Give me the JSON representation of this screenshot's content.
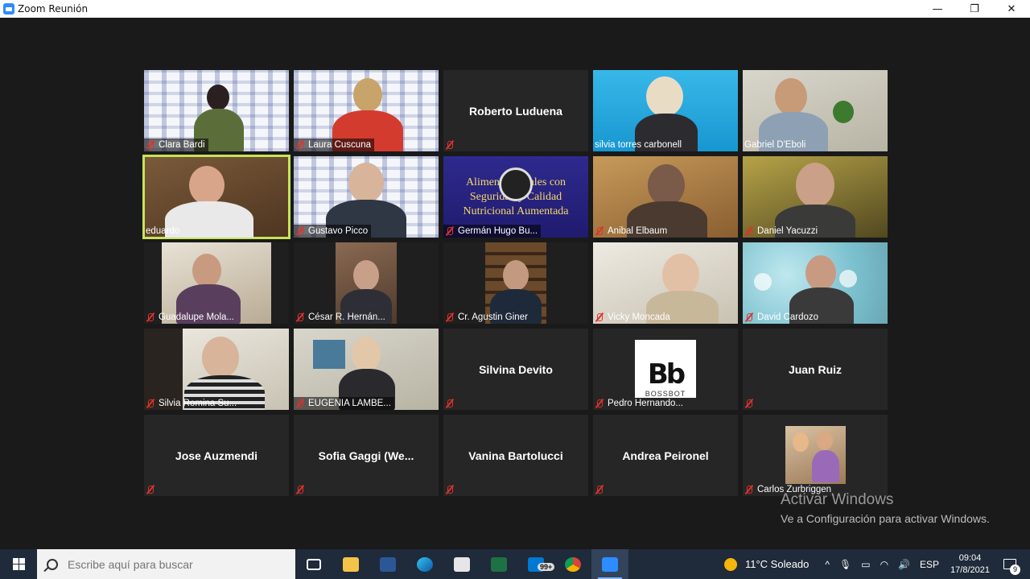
{
  "window": {
    "title": "Zoom Reunión",
    "controls": {
      "minimize": "—",
      "restore": "❐",
      "close": "✕"
    }
  },
  "participants": [
    {
      "name": "Clara Bardi",
      "muted": true,
      "video": true
    },
    {
      "name": "Laura Cuscuna",
      "muted": true,
      "video": true
    },
    {
      "name": "Roberto Luduena",
      "muted": true,
      "video": false
    },
    {
      "name": "silvia torres carbonell",
      "muted": false,
      "video": true
    },
    {
      "name": "Gabriel D'Eboli",
      "muted": false,
      "video": true
    },
    {
      "name": "eduardo",
      "muted": false,
      "video": true,
      "active_speaker": true
    },
    {
      "name": "Gustavo Picco",
      "muted": true,
      "video": true
    },
    {
      "name": "Germán Hugo Bu...",
      "muted": true,
      "video": true
    },
    {
      "name": "Anibal Elbaum",
      "muted": true,
      "video": true
    },
    {
      "name": "Daniel Yacuzzi",
      "muted": true,
      "video": true
    },
    {
      "name": "Guadalupe Mola...",
      "muted": true,
      "video": true
    },
    {
      "name": "César R. Hernán...",
      "muted": true,
      "video": true
    },
    {
      "name": "Cr. Agustin Giner",
      "muted": true,
      "video": true
    },
    {
      "name": "Vicky Moncada",
      "muted": true,
      "video": true
    },
    {
      "name": "David Cardozo",
      "muted": true,
      "video": true
    },
    {
      "name": "Silvia  Romina Su...",
      "muted": true,
      "video": true
    },
    {
      "name": "EUGENIA LAMBE...",
      "muted": true,
      "video": true
    },
    {
      "name": "Silvina Devito",
      "muted": true,
      "video": false
    },
    {
      "name": "Pedro Hernando...",
      "muted": true,
      "video": true
    },
    {
      "name": "Juan Ruiz",
      "muted": true,
      "video": false
    },
    {
      "name": "Jose Auzmendi",
      "muted": true,
      "video": false
    },
    {
      "name": "Sofia  Gaggi  (We...",
      "muted": true,
      "video": false
    },
    {
      "name": "Vanina Bartolucci",
      "muted": true,
      "video": false
    },
    {
      "name": "Andrea Peironel",
      "muted": true,
      "video": false
    },
    {
      "name": "Carlos Zurbriggen",
      "muted": true,
      "video": true
    }
  ],
  "slide": {
    "line1": "Alimentos Vitales con",
    "line2": "Seguridad y Calidad",
    "line3": "Nutricional Aumentada"
  },
  "bossbot_text": "BOSSBOT",
  "watermark": {
    "title": "Activar Windows",
    "subtitle": "Ve a Configuración para activar Windows."
  },
  "taskbar": {
    "search_placeholder": "Escribe aquí para buscar",
    "mail_badge": "99+",
    "weather": "11°C  Soleado",
    "language": "ESP",
    "time": "09:04",
    "date": "17/8/2021",
    "notifications": "9"
  },
  "colors": {
    "active_speaker": "#c6e35a",
    "muted_icon": "#e0312b",
    "taskbar": "#1f2a3a"
  }
}
